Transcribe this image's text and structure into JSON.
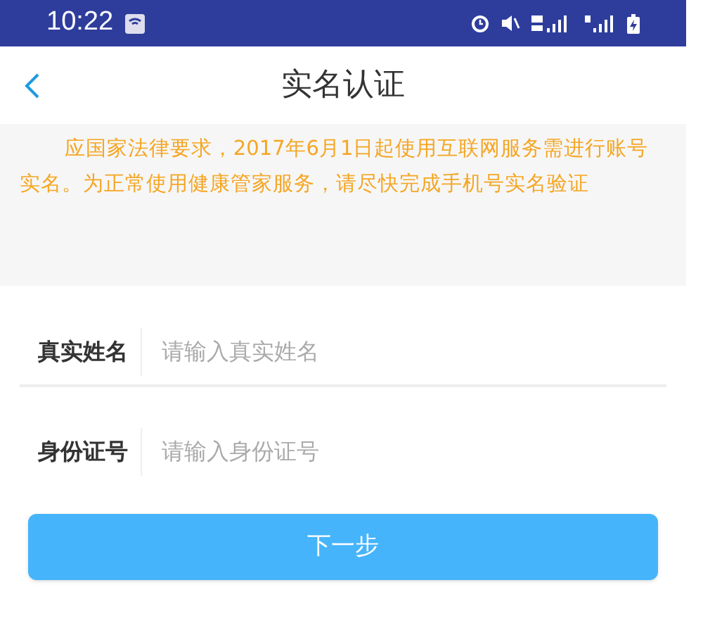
{
  "status_bar": {
    "time": "10:22"
  },
  "header": {
    "title": "实名认证"
  },
  "notice": {
    "text": "应国家法律要求，2017年6月1日起使用互联网服务需进行账号实名。为正常使用健康管家服务，请尽快完成手机号实名验证"
  },
  "form": {
    "fields": [
      {
        "label": "真实姓名",
        "placeholder": "请输入真实姓名"
      },
      {
        "label": "身份证号",
        "placeholder": "请输入身份证号"
      }
    ]
  },
  "buttons": [
    {
      "label": "下一步"
    }
  ]
}
